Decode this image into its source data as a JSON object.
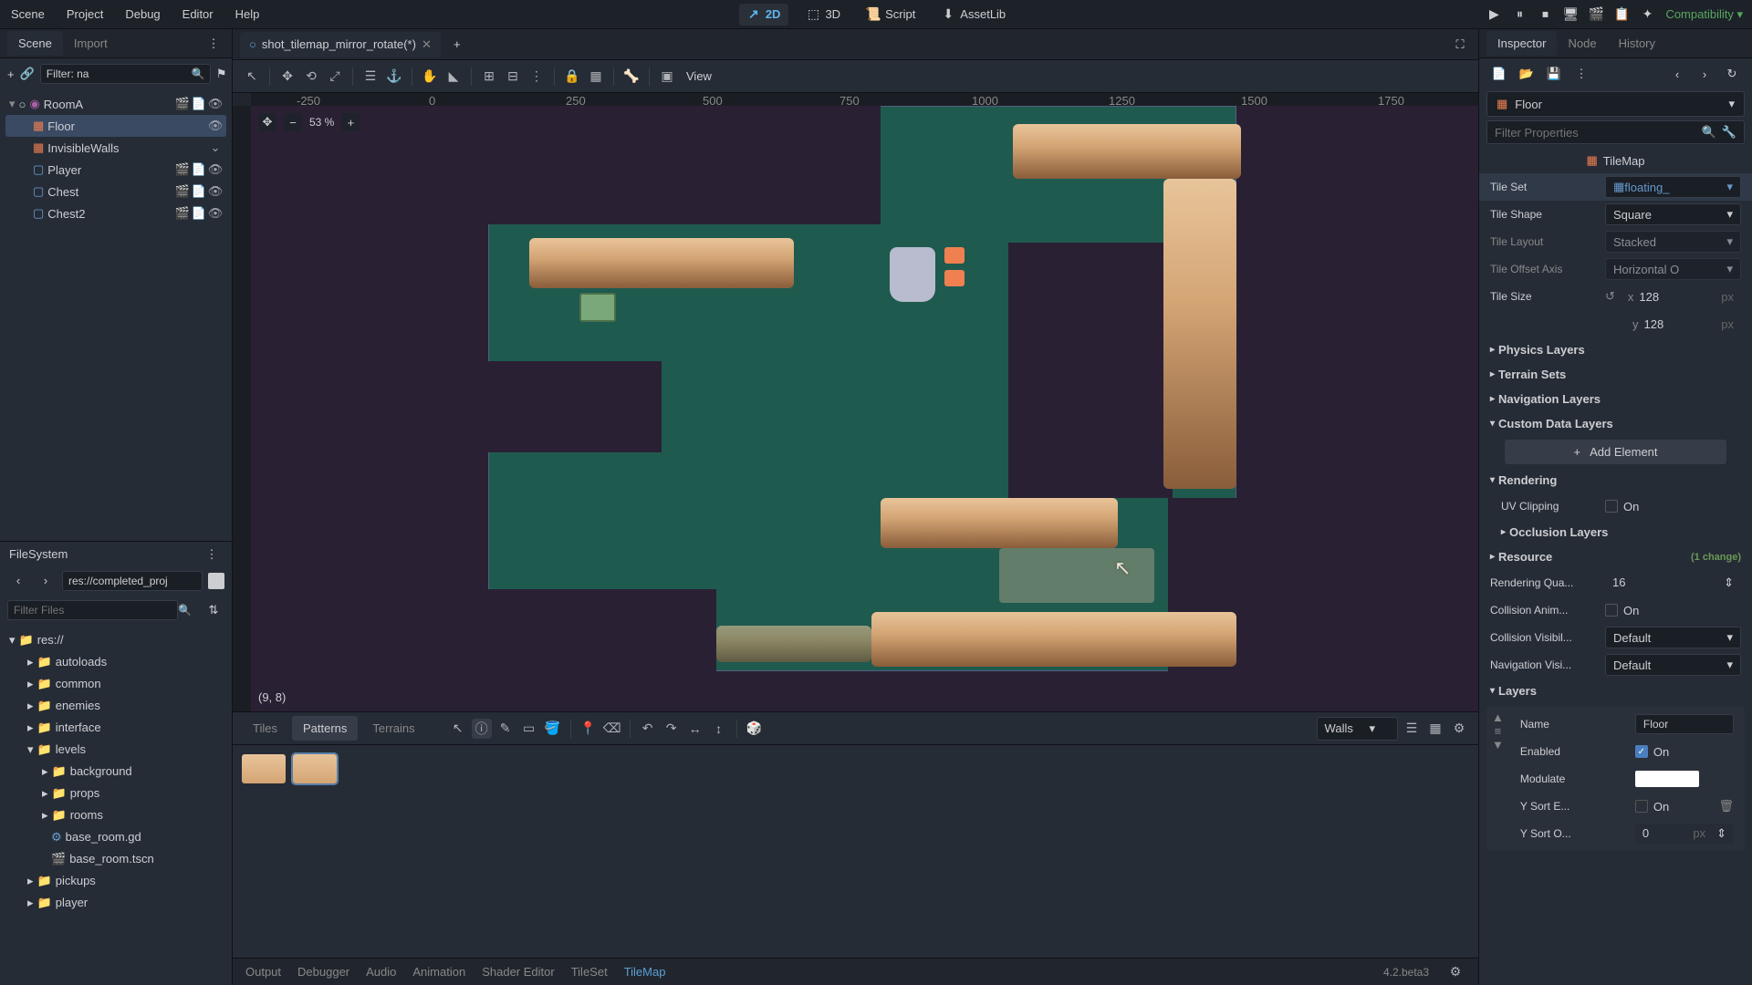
{
  "menu": {
    "scene": "Scene",
    "project": "Project",
    "debug": "Debug",
    "editor": "Editor",
    "help": "Help"
  },
  "modes": {
    "m2d": "2D",
    "m3d": "3D",
    "script": "Script",
    "assetlib": "AssetLib"
  },
  "compat": "Compatibility",
  "scene_panel": {
    "tab_scene": "Scene",
    "tab_import": "Import",
    "filter_value": "Filter: na",
    "nodes": {
      "root": "RoomA",
      "floor": "Floor",
      "walls": "InvisibleWalls",
      "player": "Player",
      "chest": "Chest",
      "chest2": "Chest2"
    }
  },
  "filesystem": {
    "title": "FileSystem",
    "path": "res://completed_proj",
    "filter_placeholder": "Filter Files",
    "tree": {
      "root": "res://",
      "autoloads": "autoloads",
      "common": "common",
      "enemies": "enemies",
      "interface": "interface",
      "levels": "levels",
      "background": "background",
      "props": "props",
      "rooms": "rooms",
      "base_room_gd": "base_room.gd",
      "base_room_tscn": "base_room.tscn",
      "pickups": "pickups",
      "player": "player"
    }
  },
  "editor": {
    "tab_name": "shot_tilemap_mirror_rotate(*)",
    "view_label": "View",
    "zoom": "53 %",
    "coord": "(9, 8)"
  },
  "ruler": {
    "n250": "-250",
    "p0": "0",
    "p250": "250",
    "p500": "500",
    "p750": "750",
    "p1000": "1000",
    "p1250": "1250",
    "p1500": "1500",
    "p1750": "1750"
  },
  "tilemap_panel": {
    "tabs": {
      "tiles": "Tiles",
      "patterns": "Patterns",
      "terrains": "Terrains"
    },
    "layer": "Walls"
  },
  "bottom_bar": {
    "output": "Output",
    "debugger": "Debugger",
    "audio": "Audio",
    "animation": "Animation",
    "shader": "Shader Editor",
    "tileset": "TileSet",
    "tilemap": "TileMap",
    "version": "4.2.beta3"
  },
  "inspector": {
    "tabs": {
      "inspector": "Inspector",
      "node": "Node",
      "history": "History"
    },
    "node_name": "Floor",
    "filter_placeholder": "Filter Properties",
    "class": "TileMap",
    "props": {
      "tile_set_label": "Tile Set",
      "tile_set_val": "floating_",
      "tile_shape_label": "Tile Shape",
      "tile_shape_val": "Square",
      "tile_layout_label": "Tile Layout",
      "tile_layout_val": "Stacked",
      "tile_offset_label": "Tile Offset Axis",
      "tile_offset_val": "Horizontal O",
      "tile_size_label": "Tile Size",
      "tile_x": "128",
      "tile_y": "128",
      "px": "px",
      "ax_x": "x",
      "ax_y": "y"
    },
    "sections": {
      "physics": "Physics Layers",
      "terrain": "Terrain Sets",
      "navigation": "Navigation Layers",
      "custom": "Custom Data Layers",
      "add_element": "Add Element",
      "rendering": "Rendering",
      "uv_clip": "UV Clipping",
      "on": "On",
      "occlusion": "Occlusion Layers",
      "resource": "Resource",
      "change1": "(1 change)",
      "render_qual": "Rendering Qua...",
      "render_qual_val": "16",
      "coll_anim": "Collision Anim...",
      "coll_vis": "Collision Visibil...",
      "default": "Default",
      "nav_vis": "Navigation Visi...",
      "layers": "Layers",
      "name_label": "Name",
      "name_val": "Floor",
      "enabled": "Enabled",
      "modulate": "Modulate",
      "ysort_e": "Y Sort E...",
      "ysort_o": "Y Sort O...",
      "ysort_o_val": "0"
    }
  }
}
